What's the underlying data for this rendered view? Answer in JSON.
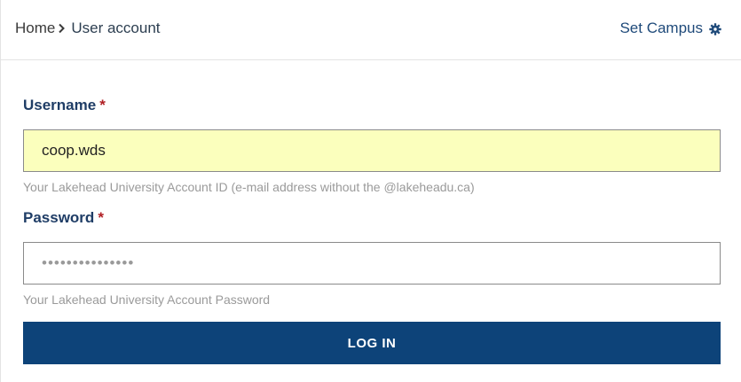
{
  "breadcrumb": {
    "home": "Home",
    "current": "User account"
  },
  "header": {
    "set_campus_label": "Set Campus",
    "set_campus_icon": "gear-icon"
  },
  "form": {
    "username": {
      "label": "Username",
      "required_marker": "*",
      "value": "coop.wds",
      "help": "Your Lakehead University Account ID (e-mail address without the @lakeheadu.ca)"
    },
    "password": {
      "label": "Password",
      "required_marker": "*",
      "value": "•••••••••••••••",
      "help": "Your Lakehead University Account Password"
    },
    "submit_label": "LOG IN"
  },
  "colors": {
    "brand_blue": "#0d4379",
    "label_blue": "#1f3d66",
    "required_red": "#b01e23",
    "autofill_yellow": "#fbffbd"
  }
}
